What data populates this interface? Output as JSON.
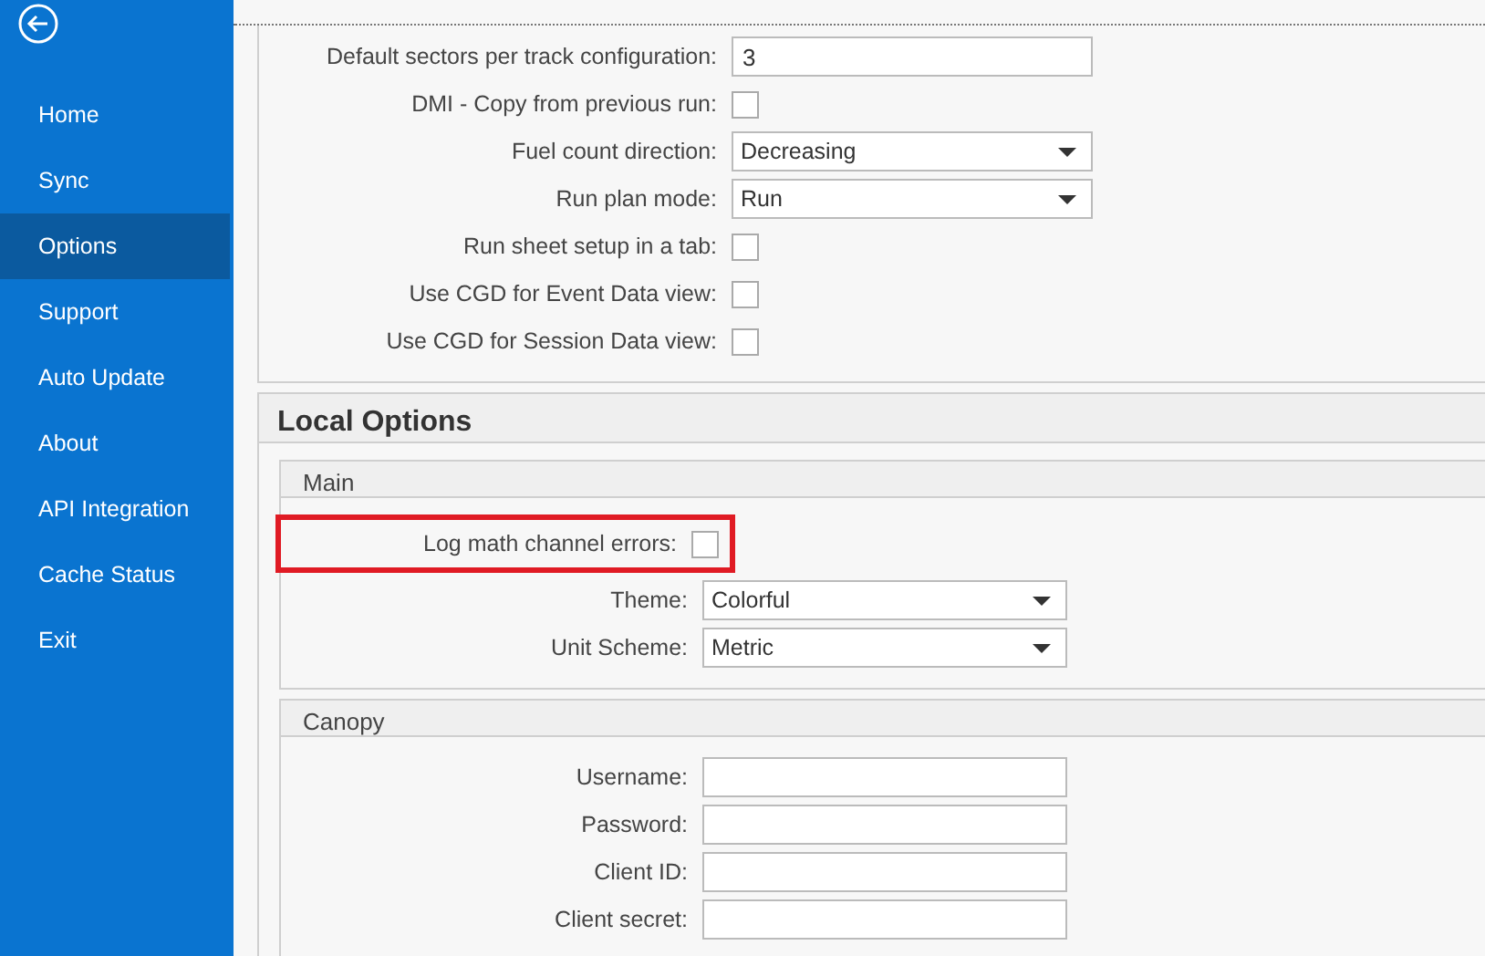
{
  "sidebar": {
    "items": [
      {
        "label": "Home",
        "selected": false
      },
      {
        "label": "Sync",
        "selected": false
      },
      {
        "label": "Options",
        "selected": true
      },
      {
        "label": "Support",
        "selected": false
      },
      {
        "label": "Auto Update",
        "selected": false
      },
      {
        "label": "About",
        "selected": false
      },
      {
        "label": "API Integration",
        "selected": false
      },
      {
        "label": "Cache Status",
        "selected": false
      },
      {
        "label": "Exit",
        "selected": false
      }
    ]
  },
  "global_options": {
    "fields": [
      {
        "kind": "text",
        "label": "Default sectors per track configuration:",
        "value": "3"
      },
      {
        "kind": "checkbox",
        "label": "DMI - Copy from previous run:",
        "checked": false
      },
      {
        "kind": "dropdown",
        "label": "Fuel count direction:",
        "value": "Decreasing"
      },
      {
        "kind": "dropdown",
        "label": "Run plan mode:",
        "value": "Run"
      },
      {
        "kind": "checkbox",
        "label": "Run sheet setup in a tab:",
        "checked": false
      },
      {
        "kind": "checkbox",
        "label": "Use CGD for Event Data view:",
        "checked": false
      },
      {
        "kind": "checkbox",
        "label": "Use CGD for Session Data view:",
        "checked": false
      }
    ]
  },
  "local_options": {
    "title": "Local Options",
    "groups": [
      {
        "title": "Main",
        "fields": [
          {
            "kind": "checkbox",
            "label": "Log math channel errors:",
            "checked": false,
            "highlighted": true
          },
          {
            "kind": "dropdown",
            "label": "Theme:",
            "value": "Colorful"
          },
          {
            "kind": "dropdown",
            "label": "Unit Scheme:",
            "value": "Metric"
          }
        ]
      },
      {
        "title": "Canopy",
        "fields": [
          {
            "kind": "text",
            "label": "Username:"
          },
          {
            "kind": "text",
            "label": "Password:"
          },
          {
            "kind": "text",
            "label": "Client ID:"
          },
          {
            "kind": "text",
            "label": "Client secret:"
          }
        ]
      }
    ]
  }
}
